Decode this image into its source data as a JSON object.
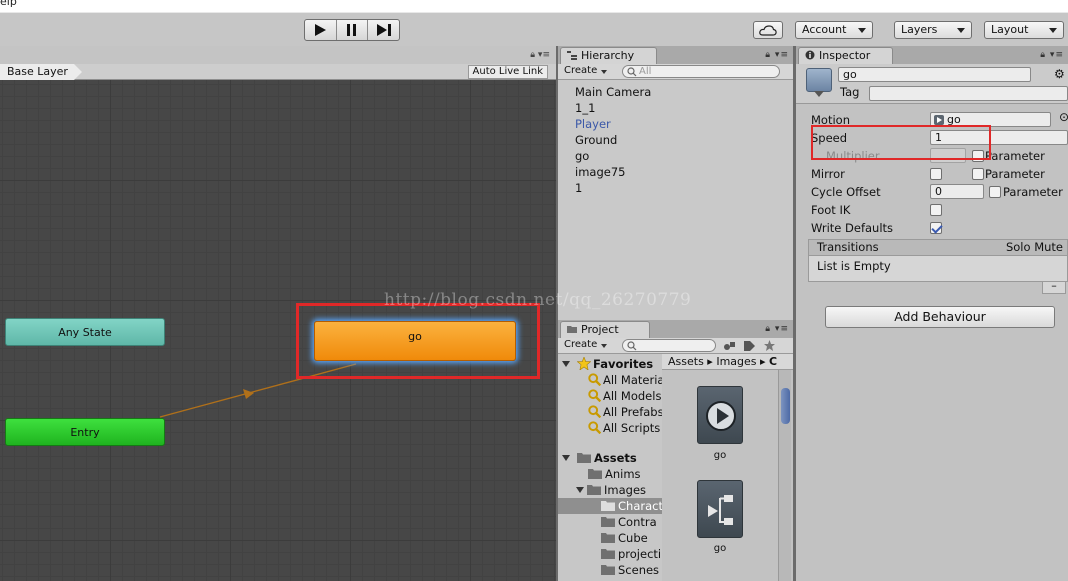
{
  "menubar": {
    "help_label": "elp"
  },
  "toolbar": {
    "account_label": "Account",
    "layers_label": "Layers",
    "layout_label": "Layout"
  },
  "animator": {
    "breadcrumb": "Base Layer",
    "auto_live_link": "Auto Live Link",
    "states": {
      "any_state": "Any State",
      "entry": "Entry",
      "go": "go"
    },
    "colors": {
      "any_state": "#6cc5b6",
      "entry": "#2ecb2e",
      "go_state": "#f59d20",
      "highlight": "#e02828",
      "transition": "#b0701a"
    }
  },
  "hierarchy": {
    "tab_label": "Hierarchy",
    "create_label": "Create",
    "search_placeholder": "All",
    "items": [
      {
        "label": "Main Camera"
      },
      {
        "label": "1_1"
      },
      {
        "label": "Player"
      },
      {
        "label": "Ground"
      },
      {
        "label": "go"
      },
      {
        "label": "image75"
      },
      {
        "label": "1"
      }
    ]
  },
  "project": {
    "tab_label": "Project",
    "create_label": "Create",
    "favorites_label": "Favorites",
    "favorites": [
      "All Materia",
      "All Models",
      "All Prefabs",
      "All Scripts"
    ],
    "assets_label": "Assets",
    "tree": [
      "Anims",
      "Images",
      "Charact",
      "Contra",
      "Cube",
      "projecti",
      "Scenes"
    ],
    "breadcrumb": [
      "Assets",
      "Images",
      "C"
    ],
    "grid_items": [
      {
        "label": "go",
        "icon": "play-clip-icon"
      },
      {
        "label": "go",
        "icon": "blend-tree-icon"
      }
    ]
  },
  "inspector": {
    "tab_label": "Inspector",
    "object_name": "go",
    "tag_label": "Tag",
    "motion_label": "Motion",
    "motion_value": "go",
    "speed_label": "Speed",
    "speed_value": "1",
    "multiplier_label": "Multiplier",
    "parameter_label": "Parameter",
    "mirror_label": "Mirror",
    "cycle_offset_label": "Cycle Offset",
    "cycle_offset_value": "0",
    "foot_ik_label": "Foot IK",
    "write_defaults_label": "Write Defaults",
    "write_defaults_checked": true,
    "transitions_label": "Transitions",
    "solo_mute_label": "Solo Mute",
    "list_empty": "List is Empty",
    "add_behaviour_label": "Add Behaviour",
    "minus_label": "–"
  },
  "watermark": "http://blog.csdn.net/qq_26270779"
}
